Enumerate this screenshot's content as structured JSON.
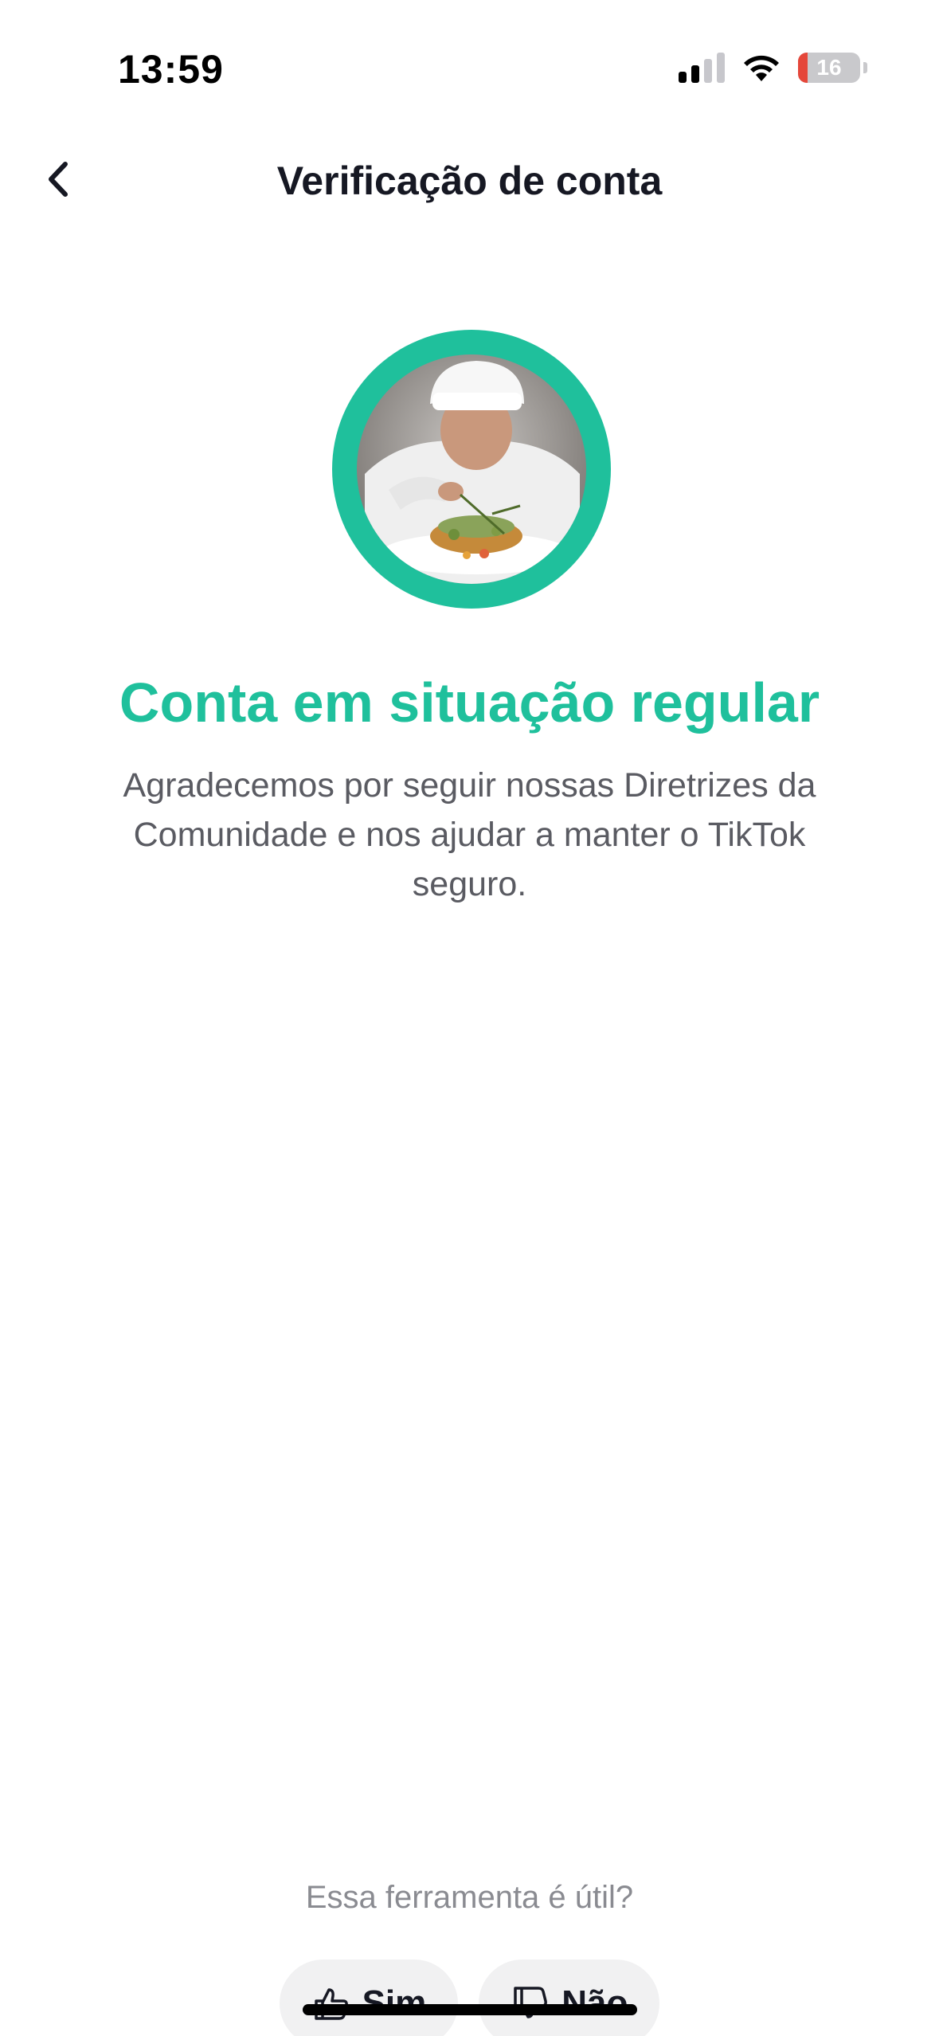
{
  "status_bar": {
    "time": "13:59",
    "battery_level": "16",
    "signal_bars_active": 2,
    "signal_bars_total": 4,
    "battery_fraction": 0.16,
    "battery_color": "#e5473a"
  },
  "nav": {
    "title": "Verificação de conta",
    "back_icon": "chevron-left-icon"
  },
  "status": {
    "headline": "Conta em situação regular",
    "description": "Agradecemos por seguir nossas Diretrizes da Comunidade e nos ajudar a manter o TikTok seguro.",
    "accent_color": "#1fc09c"
  },
  "feedback": {
    "question": "Essa ferramenta é útil?",
    "yes_label": "Sim",
    "no_label": "Não",
    "yes_icon": "thumbs-up-icon",
    "no_icon": "thumbs-down-icon"
  }
}
